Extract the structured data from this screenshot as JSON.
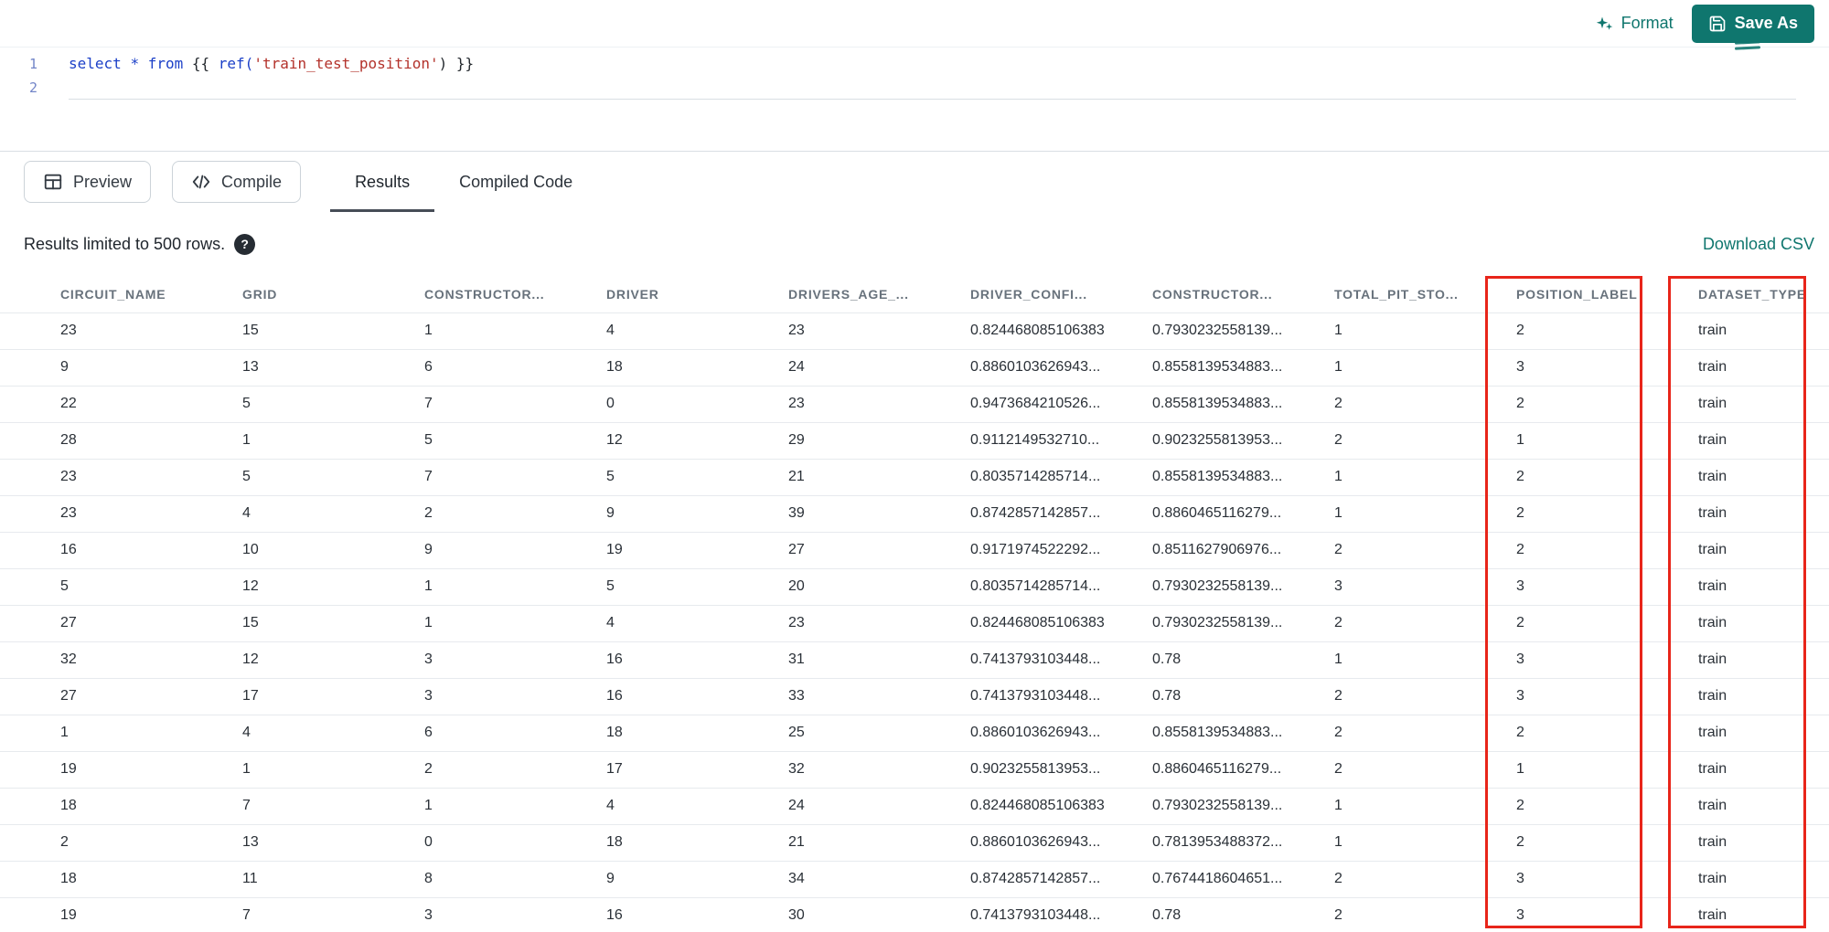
{
  "colors": {
    "accent": "#0f766e",
    "highlight": "#e8251a",
    "kw": "#1c40c8",
    "str": "#b3322b"
  },
  "toolbar": {
    "format_label": "Format",
    "save_as_label": "Save As"
  },
  "editor": {
    "line_numbers": [
      "1",
      "2"
    ],
    "code_line_1": "select * from {{ ref('train_test_position') }}",
    "tokens": [
      {
        "text": "select",
        "type": "keyword"
      },
      {
        "text": " ",
        "type": "plain"
      },
      {
        "text": "*",
        "type": "keyword"
      },
      {
        "text": " ",
        "type": "plain"
      },
      {
        "text": "from",
        "type": "keyword"
      },
      {
        "text": " {{ ",
        "type": "plain"
      },
      {
        "text": "ref(",
        "type": "function"
      },
      {
        "text": "'train_test_position'",
        "type": "string"
      },
      {
        "text": ") }}",
        "type": "plain"
      }
    ]
  },
  "actions": {
    "preview_label": "Preview",
    "compile_label": "Compile",
    "tabs": [
      {
        "label": "Results",
        "active": true
      },
      {
        "label": "Compiled Code",
        "active": false
      }
    ]
  },
  "results": {
    "limit_note": "Results limited to 500 rows.",
    "help_glyph": "?",
    "download_csv_label": "Download CSV"
  },
  "table": {
    "columns": [
      "CIRCUIT_NAME",
      "GRID",
      "CONSTRUCTOR...",
      "DRIVER",
      "DRIVERS_AGE_...",
      "DRIVER_CONFI...",
      "CONSTRUCTOR...",
      "TOTAL_PIT_STO...",
      "POSITION_LABEL",
      "DATASET_TYPE"
    ],
    "highlighted_columns": [
      "POSITION_LABEL",
      "DATASET_TYPE"
    ],
    "rows": [
      [
        23,
        15,
        1,
        4,
        23,
        "0.824468085106383",
        "0.7930232558139...",
        1,
        2,
        "train"
      ],
      [
        9,
        13,
        6,
        18,
        24,
        "0.8860103626943...",
        "0.8558139534883...",
        1,
        3,
        "train"
      ],
      [
        22,
        5,
        7,
        0,
        23,
        "0.9473684210526...",
        "0.8558139534883...",
        2,
        2,
        "train"
      ],
      [
        28,
        1,
        5,
        12,
        29,
        "0.9112149532710...",
        "0.9023255813953...",
        2,
        1,
        "train"
      ],
      [
        23,
        5,
        7,
        5,
        21,
        "0.8035714285714...",
        "0.8558139534883...",
        1,
        2,
        "train"
      ],
      [
        23,
        4,
        2,
        9,
        39,
        "0.8742857142857...",
        "0.8860465116279...",
        1,
        2,
        "train"
      ],
      [
        16,
        10,
        9,
        19,
        27,
        "0.9171974522292...",
        "0.8511627906976...",
        2,
        2,
        "train"
      ],
      [
        5,
        12,
        1,
        5,
        20,
        "0.8035714285714...",
        "0.7930232558139...",
        3,
        3,
        "train"
      ],
      [
        27,
        15,
        1,
        4,
        23,
        "0.824468085106383",
        "0.7930232558139...",
        2,
        2,
        "train"
      ],
      [
        32,
        12,
        3,
        16,
        31,
        "0.7413793103448...",
        "0.78",
        1,
        3,
        "train"
      ],
      [
        27,
        17,
        3,
        16,
        33,
        "0.7413793103448...",
        "0.78",
        2,
        3,
        "train"
      ],
      [
        1,
        4,
        6,
        18,
        25,
        "0.8860103626943...",
        "0.8558139534883...",
        2,
        2,
        "train"
      ],
      [
        19,
        1,
        2,
        17,
        32,
        "0.9023255813953...",
        "0.8860465116279...",
        2,
        1,
        "train"
      ],
      [
        18,
        7,
        1,
        4,
        24,
        "0.824468085106383",
        "0.7930232558139...",
        1,
        2,
        "train"
      ],
      [
        2,
        13,
        0,
        18,
        21,
        "0.8860103626943...",
        "0.7813953488372...",
        1,
        2,
        "train"
      ],
      [
        18,
        11,
        8,
        9,
        34,
        "0.8742857142857...",
        "0.7674418604651...",
        2,
        3,
        "train"
      ],
      [
        19,
        7,
        3,
        16,
        30,
        "0.7413793103448...",
        "0.78",
        2,
        3,
        "train"
      ]
    ]
  }
}
